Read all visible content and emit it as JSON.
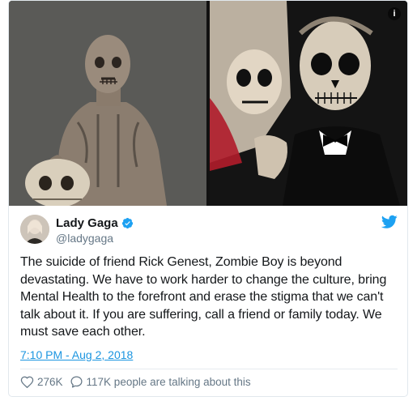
{
  "media": {
    "left_photo": "tattooed-man-holding-skull-photo",
    "right_photo": "skull-makeup-couple-photo",
    "info_badge": "i"
  },
  "author": {
    "name": "Lady Gaga",
    "handle": "@ladygaga",
    "verified": true,
    "avatar": "user-avatar"
  },
  "tweet": {
    "text": "The suicide of friend Rick Genest, Zombie Boy is beyond devastating. We have to work harder to change the culture, bring Mental Health to the forefront and erase the stigma that we can't talk about it. If you are suffering, call a friend or family today. We must save each other.",
    "timestamp": "7:10 PM - Aug 2, 2018"
  },
  "actions": {
    "likes": "276K",
    "replies_text": "117K people are talking about this"
  },
  "colors": {
    "accent": "#1da1f2",
    "link": "#1b95e0",
    "muted": "#657786",
    "like_icon": "#657786",
    "twitter_bird": "#1da1f2"
  },
  "icons": [
    "info-icon",
    "verified-badge-icon",
    "twitter-bird-icon",
    "heart-icon",
    "reply-bubble-icon"
  ]
}
